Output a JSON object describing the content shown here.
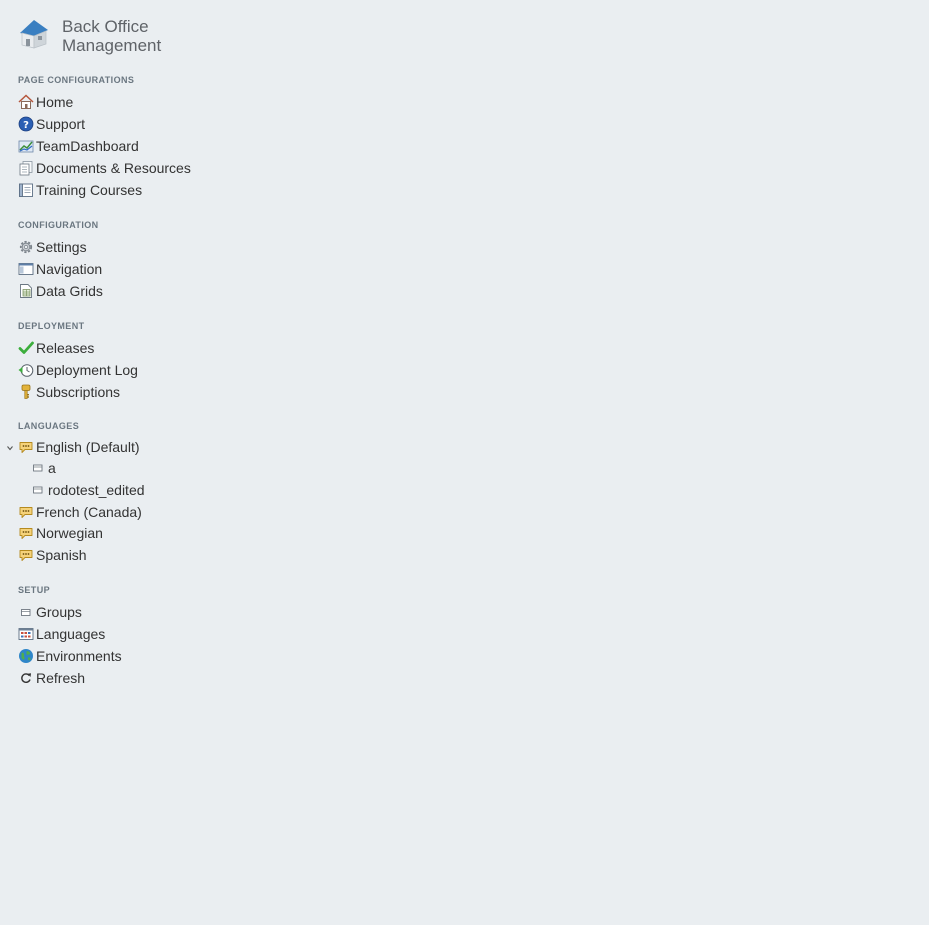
{
  "app": {
    "title_line1": "Back Office",
    "title_line2": "Management"
  },
  "sections": {
    "page_configurations": {
      "title": "PAGE CONFIGURATIONS",
      "items": [
        {
          "label": "Home",
          "icon": "home-icon"
        },
        {
          "label": "Support",
          "icon": "help-icon"
        },
        {
          "label": "TeamDashboard",
          "icon": "chart-icon"
        },
        {
          "label": "Documents & Resources",
          "icon": "documents-icon"
        },
        {
          "label": "Training Courses",
          "icon": "book-icon"
        }
      ]
    },
    "configuration": {
      "title": "CONFIGURATION",
      "items": [
        {
          "label": "Settings",
          "icon": "gear-icon"
        },
        {
          "label": "Navigation",
          "icon": "window-icon"
        },
        {
          "label": "Data Grids",
          "icon": "grid-document-icon"
        }
      ]
    },
    "deployment": {
      "title": "DEPLOYMENT",
      "items": [
        {
          "label": "Releases",
          "icon": "checkmark-icon"
        },
        {
          "label": "Deployment Log",
          "icon": "clock-history-icon"
        },
        {
          "label": "Subscriptions",
          "icon": "key-icon"
        }
      ]
    },
    "languages": {
      "title": "LANGUAGES",
      "items": [
        {
          "label": "English (Default)",
          "icon": "speech-bubble-icon",
          "expanded": true,
          "children": [
            {
              "label": "a",
              "icon": "folder-icon"
            },
            {
              "label": "rodotest_edited",
              "icon": "folder-icon"
            }
          ]
        },
        {
          "label": "French (Canada)",
          "icon": "speech-bubble-icon"
        },
        {
          "label": "Norwegian",
          "icon": "speech-bubble-icon"
        },
        {
          "label": "Spanish",
          "icon": "speech-bubble-icon"
        }
      ]
    },
    "setup": {
      "title": "SETUP",
      "items": [
        {
          "label": "Groups",
          "icon": "folder-icon"
        },
        {
          "label": "Languages",
          "icon": "language-table-icon"
        },
        {
          "label": "Environments",
          "icon": "globe-icon"
        },
        {
          "label": "Refresh",
          "icon": "refresh-icon"
        }
      ]
    }
  },
  "colors": {
    "background": "#eaeef1",
    "section_title": "#6a7680",
    "text": "#333333",
    "logo_blue": "#3a7fc1",
    "check_green": "#3cae3c",
    "bubble_yellow": "#f0c24a"
  }
}
